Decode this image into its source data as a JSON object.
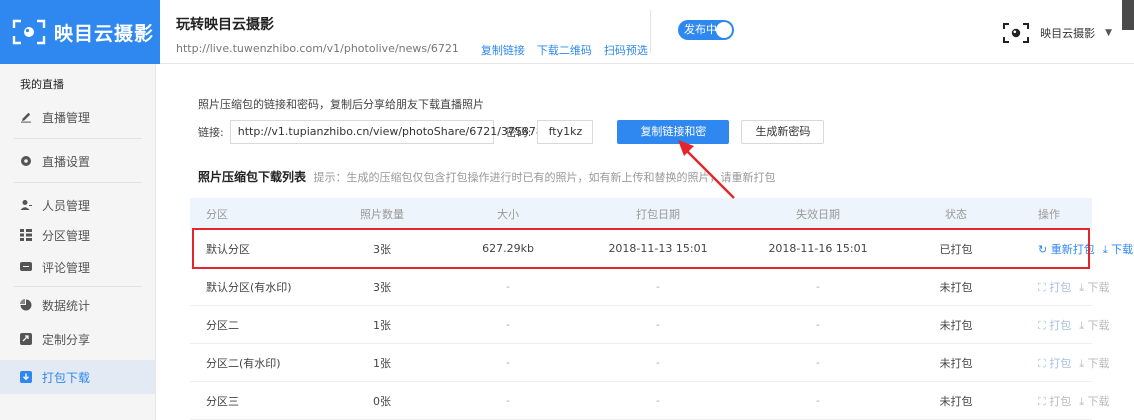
{
  "brand": {
    "name": "映目云摄影",
    "color": "#2f88f0"
  },
  "header": {
    "title": "玩转映目云摄影",
    "url": "http://live.tuwenzhibo.com/v1/photolive/news/6721",
    "links": [
      "复制链接",
      "下载二维码",
      "扫码预选"
    ],
    "publish_label": "发布中",
    "user_name": "映目云摄影",
    "user_caret": "▼"
  },
  "sidebar": {
    "heading": "我的直播",
    "items": [
      {
        "label": "直播管理",
        "icon": "pencil-icon"
      },
      {
        "label": "直播设置",
        "icon": "gear-icon"
      },
      {
        "label": "人员管理",
        "icon": "user-icon"
      },
      {
        "label": "分区管理",
        "icon": "grid-icon"
      },
      {
        "label": "评论管理",
        "icon": "comment-icon"
      },
      {
        "label": "数据统计",
        "icon": "pie-icon"
      },
      {
        "label": "定制分享",
        "icon": "share-icon"
      },
      {
        "label": "打包下载",
        "icon": "download-icon",
        "active": true
      }
    ]
  },
  "main": {
    "intro": "照片压缩包的链接和密码，复制后分享给朋友下载直播照片",
    "link_label": "链接:",
    "link_value": "http://v1.tupianzhibo.cn/view/photoShare/6721/375878",
    "password_label": "密码:",
    "password_value": "fty1kz",
    "copy_button": "复制链接和密码",
    "new_password_button": "生成新密码",
    "list_title": "照片压缩包下载列表",
    "list_tip": "提示：生成的压缩包仅包含打包操作进行时已有的照片，如有新上传和替换的照片，请重新打包"
  },
  "table": {
    "columns": [
      "分区",
      "照片数量",
      "大小",
      "打包日期",
      "失效日期",
      "状态",
      "操作"
    ],
    "rows": [
      {
        "name": "默认分区",
        "count": "3张",
        "size": "627.29kb",
        "packed": "2018-11-13 15:01",
        "expires": "2018-11-16 15:01",
        "status": "已打包",
        "op1": "↻ 重新打包",
        "op2": "⤓ 下载",
        "op1_state": "active",
        "op2_state": "active"
      },
      {
        "name": "默认分区(有水印)",
        "count": "3张",
        "size": "-",
        "packed": "-",
        "expires": "-",
        "status": "未打包",
        "op1": "⛶ 打包",
        "op2": "⤓ 下载",
        "op1_state": "muted",
        "op2_state": "grey"
      },
      {
        "name": "分区二",
        "count": "1张",
        "size": "-",
        "packed": "-",
        "expires": "-",
        "status": "未打包",
        "op1": "⛶ 打包",
        "op2": "⤓ 下载",
        "op1_state": "muted",
        "op2_state": "grey"
      },
      {
        "name": "分区二(有水印)",
        "count": "1张",
        "size": "-",
        "packed": "-",
        "expires": "-",
        "status": "未打包",
        "op1": "⛶ 打包",
        "op2": "⤓ 下载",
        "op1_state": "muted",
        "op2_state": "grey"
      },
      {
        "name": "分区三",
        "count": "0张",
        "size": "-",
        "packed": "-",
        "expires": "-",
        "status": "未打包",
        "op1": "⛶ 打包",
        "op2": "⤓ 下载",
        "op1_state": "grey",
        "op2_state": "grey"
      }
    ]
  },
  "annotation": {
    "highlight_color": "#e3262c"
  }
}
